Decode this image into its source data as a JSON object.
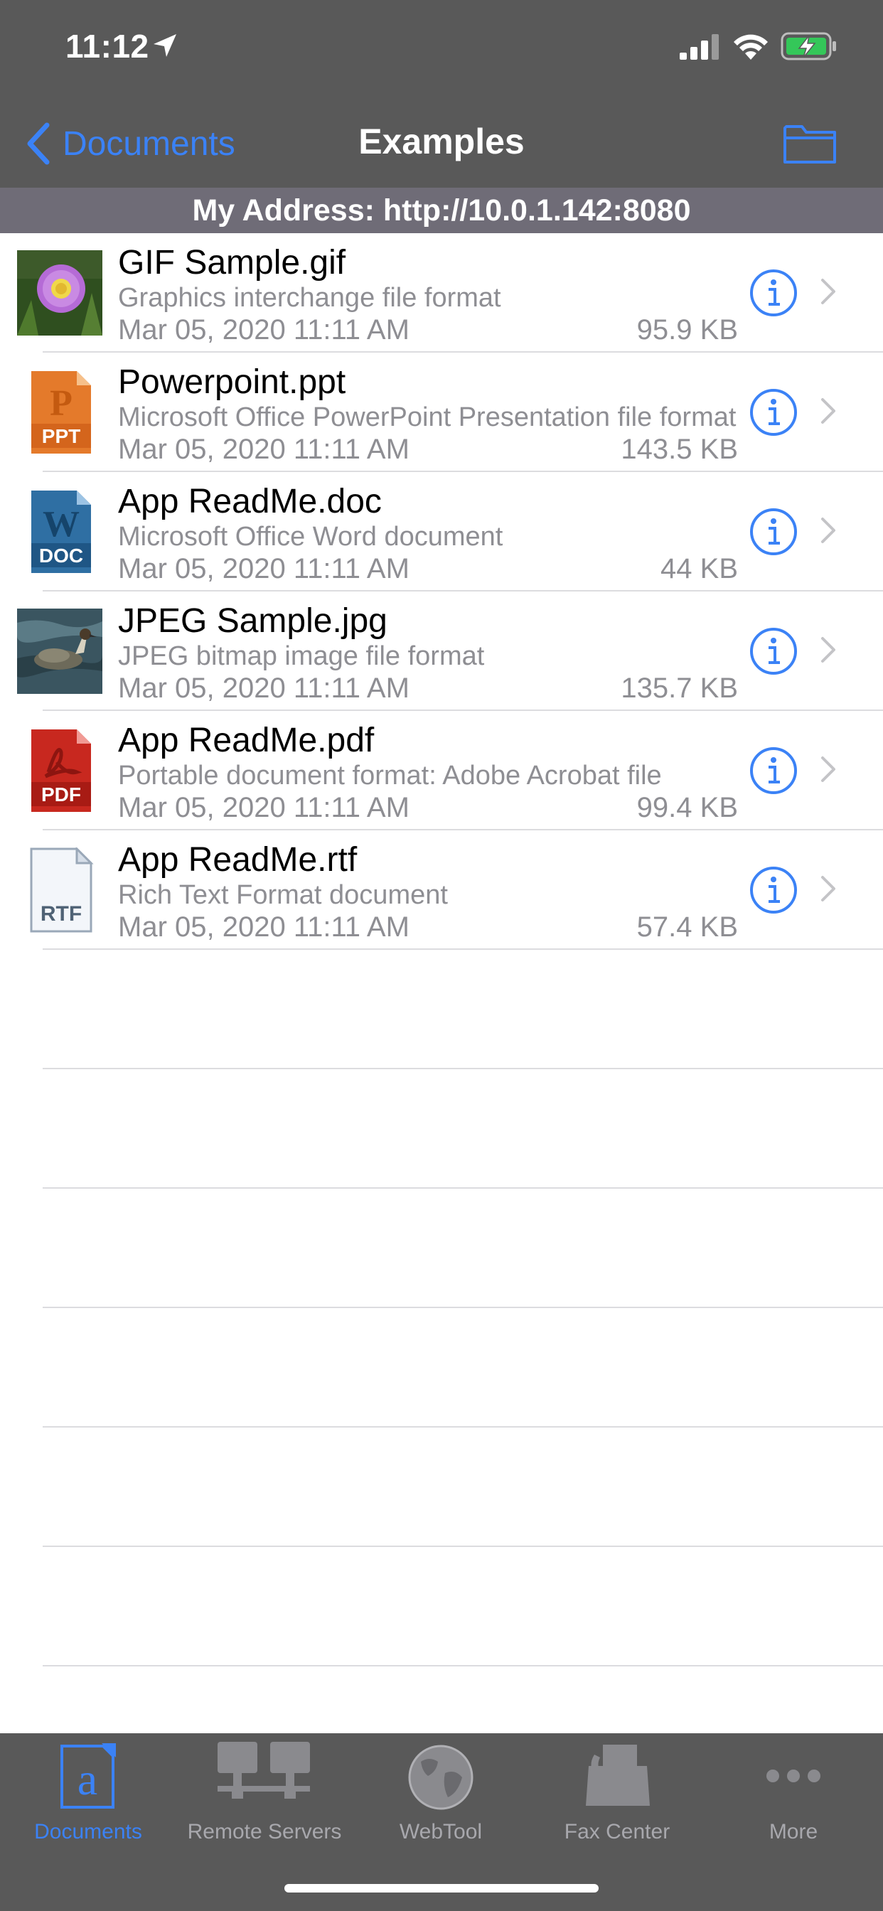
{
  "status_bar": {
    "time": "11:12"
  },
  "nav": {
    "back_label": "Documents",
    "title": "Examples"
  },
  "address_bar": {
    "text": "My Address: http://10.0.1.142:8080"
  },
  "colors": {
    "accent": "#3b82f6",
    "chrome": "#595959",
    "address_bg": "#6f6c77"
  },
  "files": [
    {
      "name": "GIF Sample.gif",
      "description": "Graphics interchange file format",
      "date": "Mar 05, 2020 11:11 AM",
      "size": "95.9 KB",
      "icon": "flower-photo-thumbnail"
    },
    {
      "name": "Powerpoint.ppt",
      "description": "Microsoft Office PowerPoint Presentation file format",
      "date": "Mar 05, 2020 11:11 AM",
      "size": "143.5 KB",
      "icon": "ppt-file-icon",
      "badge": "PPT",
      "letter": "P"
    },
    {
      "name": "App ReadMe.doc",
      "description": "Microsoft Office Word document",
      "date": "Mar 05, 2020 11:11 AM",
      "size": "44 KB",
      "icon": "doc-file-icon",
      "badge": "DOC",
      "letter": "W"
    },
    {
      "name": "JPEG Sample.jpg",
      "description": "JPEG bitmap image file format",
      "date": "Mar 05, 2020 11:11 AM",
      "size": "135.7 KB",
      "icon": "duck-photo-thumbnail"
    },
    {
      "name": "App ReadMe.pdf",
      "description": "Portable document format: Adobe Acrobat file",
      "date": "Mar 05, 2020 11:11 AM",
      "size": "99.4 KB",
      "icon": "pdf-file-icon",
      "badge": "PDF"
    },
    {
      "name": "App ReadMe.rtf",
      "description": "Rich Text Format document",
      "date": "Mar 05, 2020 11:11 AM",
      "size": "57.4 KB",
      "icon": "rtf-file-icon",
      "badge": "RTF"
    }
  ],
  "tabs": [
    {
      "label": "Documents",
      "icon": "documents-icon",
      "active": true
    },
    {
      "label": "Remote Servers",
      "icon": "remote-servers-icon",
      "active": false
    },
    {
      "label": "WebTool",
      "icon": "globe-icon",
      "active": false
    },
    {
      "label": "Fax Center",
      "icon": "fax-icon",
      "active": false
    },
    {
      "label": "More",
      "icon": "more-icon",
      "active": false
    }
  ]
}
